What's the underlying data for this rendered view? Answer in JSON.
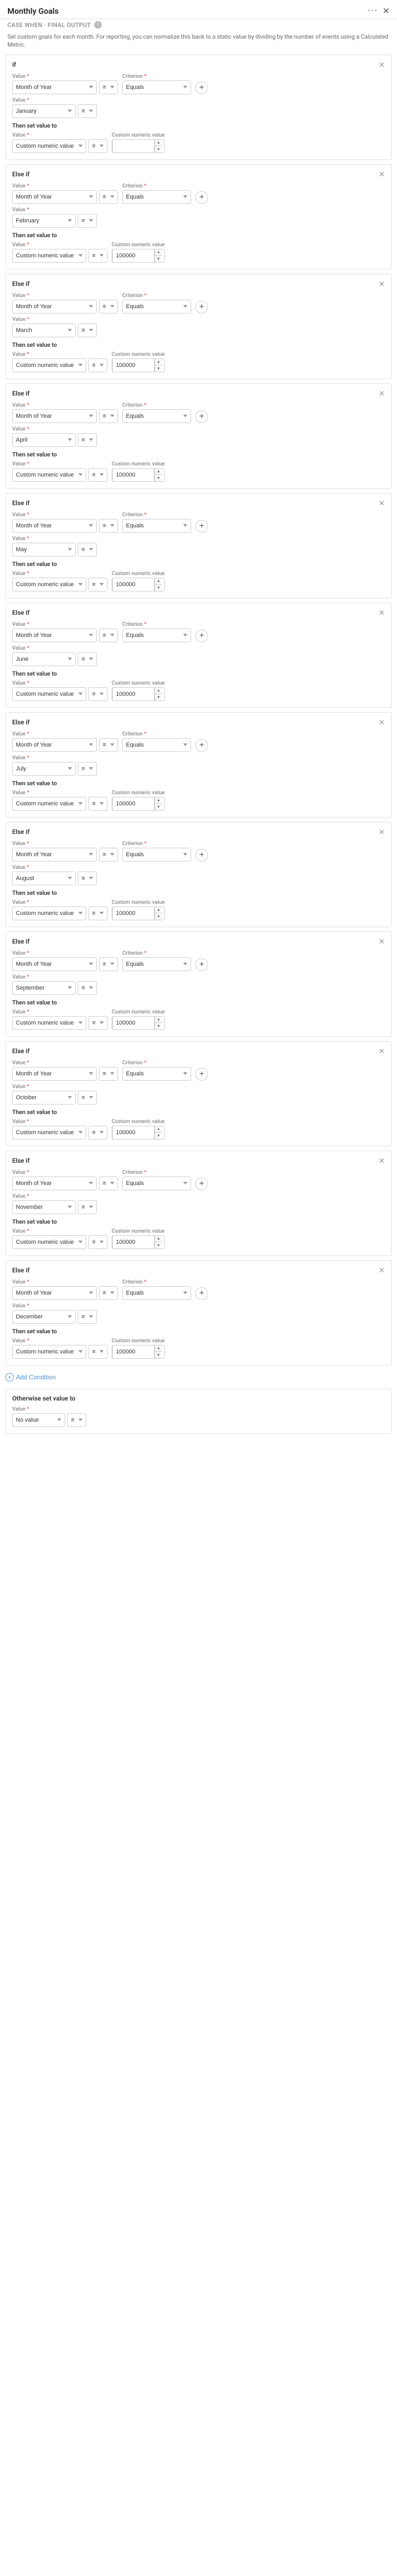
{
  "header": {
    "title": "Monthly Goals",
    "subtitle": "CASE WHEN · FINAL OUTPUT",
    "description": "Set custom goals for each month. For reporting, you can normalize this back to a static value by dividing by the number of events using a Calculated Metric."
  },
  "labels": {
    "if": "if",
    "else_if": "Else if",
    "then_set_value_to": "Then set value to",
    "otherwise_set_value_to": "Otherwise set value to",
    "add_condition": "Add Condition",
    "value": "Value",
    "criterion": "Criterion",
    "custom_numeric_value": "Custom numeric value",
    "no_value": "No value",
    "equals": "Equals"
  },
  "conditions": [
    {
      "id": 1,
      "type": "if",
      "month": "January",
      "value": ""
    },
    {
      "id": 2,
      "type": "else_if",
      "month": "February",
      "value": "100000"
    },
    {
      "id": 3,
      "type": "else_if",
      "month": "March",
      "value": "100000"
    },
    {
      "id": 4,
      "type": "else_if",
      "month": "April",
      "value": "100000"
    },
    {
      "id": 5,
      "type": "else_if",
      "month": "May",
      "value": "100000"
    },
    {
      "id": 6,
      "type": "else_if",
      "month": "June",
      "value": "100000"
    },
    {
      "id": 7,
      "type": "else_if",
      "month": "July",
      "value": "100000"
    },
    {
      "id": 8,
      "type": "else_if",
      "month": "August",
      "value": "100000"
    },
    {
      "id": 9,
      "type": "else_if",
      "month": "September",
      "value": "100000"
    },
    {
      "id": 10,
      "type": "else_if",
      "month": "October",
      "value": "100000"
    },
    {
      "id": 11,
      "type": "else_if",
      "month": "November",
      "value": "100000"
    },
    {
      "id": 12,
      "type": "else_if",
      "month": "December",
      "value": "100000"
    }
  ],
  "value_field": "Value",
  "value_asterisk": "*",
  "criterion_field": "Criterion",
  "criterion_asterisk": "*",
  "month_of_year": "Month of Year",
  "equals_label": "Equals",
  "custom_numeric": "Custom numeric value",
  "no_value_label": "No value"
}
